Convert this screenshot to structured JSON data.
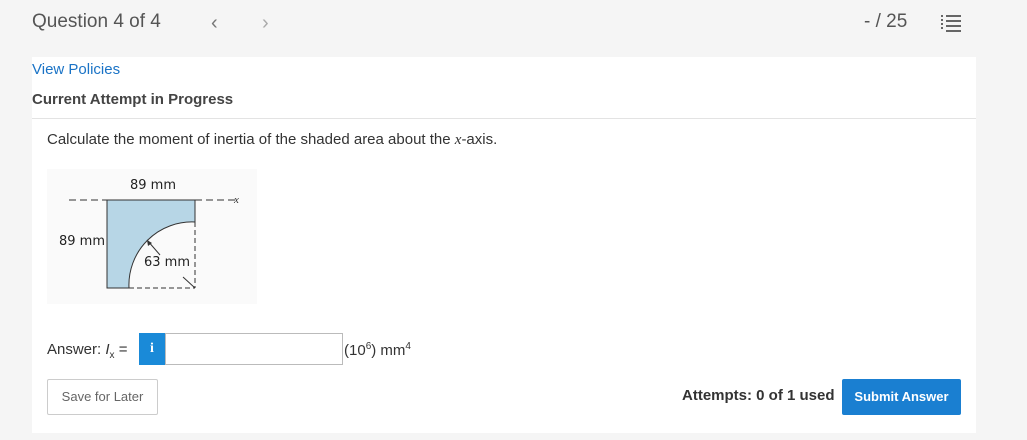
{
  "header": {
    "question_title": "Question 4 of 4",
    "prev_glyph": "‹",
    "next_glyph": "›",
    "score": "- / 25",
    "list_icon": "list-icon"
  },
  "links": {
    "view_policies": "View Policies"
  },
  "attempt_heading": "Current Attempt in Progress",
  "question": {
    "text_before": "Calculate the moment of inertia of the shaded area about the ",
    "variable": "x",
    "text_after": "-axis."
  },
  "figure": {
    "top_dim": "89 mm",
    "left_dim": "89 mm",
    "radius_dim": "63 mm",
    "axis_label": "x",
    "shade_color": "#b7d6e6"
  },
  "answer": {
    "label_prefix": "Answer: ",
    "symbol": "I",
    "subscript": "x",
    "equals": " =",
    "info_glyph": "i",
    "input_value": "",
    "units_prefix": "(10",
    "units_exp": "6",
    "units_mid": ") mm",
    "units_pow": "4"
  },
  "footer": {
    "save_label": "Save for Later",
    "attempts_text": "Attempts: 0 of 1 used",
    "submit_label": "Submit Answer"
  },
  "colors": {
    "accent": "#1a7fd1",
    "link": "#1a73c6"
  }
}
